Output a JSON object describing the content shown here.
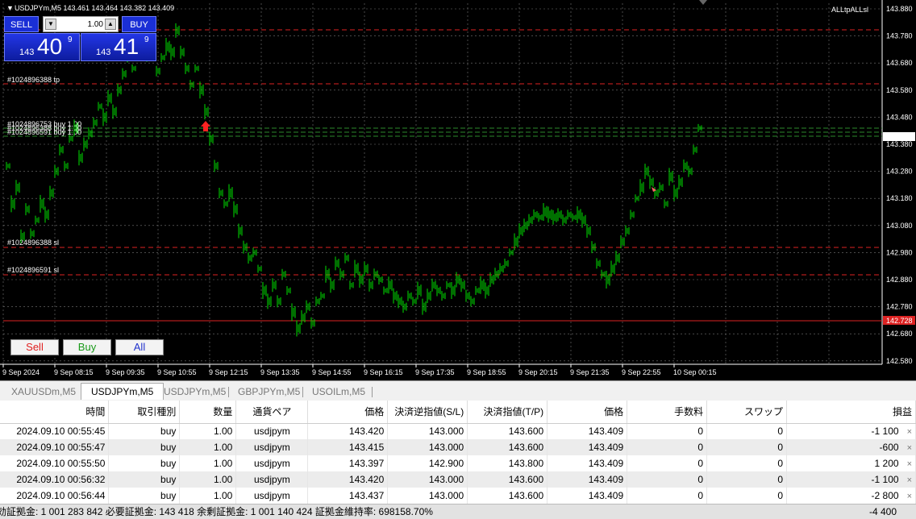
{
  "chart": {
    "symbol_header": "USDJPYm,M5  143.461 143.464 143.382 143.409",
    "ea_label": "ALLtpALLsl",
    "price_labels": [
      "143.880",
      "143.780",
      "143.680",
      "143.580",
      "143.480",
      "143.380",
      "143.280",
      "143.180",
      "143.080",
      "142.980",
      "142.880",
      "142.780",
      "142.680",
      "142.580"
    ],
    "current_price": "143.409",
    "red_price": "142.728",
    "time_labels": [
      "9 Sep 2024",
      "9 Sep 08:15",
      "9 Sep 09:35",
      "9 Sep 10:55",
      "9 Sep 12:15",
      "9 Sep 13:35",
      "9 Sep 14:55",
      "9 Sep 16:15",
      "9 Sep 17:35",
      "9 Sep 18:55",
      "9 Sep 20:15",
      "9 Sep 21:35",
      "9 Sep 22:55",
      "10 Sep 00:15"
    ],
    "order_labels": {
      "tp": "#1024896388 tp",
      "buys": [
        "#1024896753 buy 1.00",
        "#1024896388 buy 1.00",
        "#1024896591 buy 1.00"
      ],
      "sl1": "#1024896388 sl",
      "sl2": "#1024896591 sl"
    }
  },
  "trade_panel": {
    "sell_label": "SELL",
    "buy_label": "BUY",
    "lot": "1.00",
    "sell_small": "143",
    "sell_big": "40",
    "sell_sup": "9",
    "buy_small": "143",
    "buy_big": "41",
    "buy_sup": "9",
    "colors": {
      "panel": "#1a2fd6"
    }
  },
  "chart_buttons": {
    "sell": "Sell",
    "buy": "Buy",
    "all": "All"
  },
  "tabs": [
    "XAUUSDm,M5",
    "USDJPYm,M5",
    "USDJPYm,M5",
    "GBPJPYm,M5",
    "USOILm,M5"
  ],
  "table": {
    "headers": [
      "時間",
      "取引種別",
      "数量",
      "通貨ペア",
      "価格",
      "決済逆指値(S/L)",
      "決済指値(T/P)",
      "価格",
      "手数料",
      "スワップ",
      "損益"
    ],
    "rows": [
      [
        "2024.09.10 00:55:45",
        "buy",
        "1.00",
        "usdjpym",
        "143.420",
        "143.000",
        "143.600",
        "143.409",
        "0",
        "0",
        "-1 100"
      ],
      [
        "2024.09.10 00:55:47",
        "buy",
        "1.00",
        "usdjpym",
        "143.415",
        "143.000",
        "143.600",
        "143.409",
        "0",
        "0",
        "-600"
      ],
      [
        "2024.09.10 00:55:50",
        "buy",
        "1.00",
        "usdjpym",
        "143.397",
        "142.900",
        "143.800",
        "143.409",
        "0",
        "0",
        "1 200"
      ],
      [
        "2024.09.10 00:56:32",
        "buy",
        "1.00",
        "usdjpym",
        "143.420",
        "143.000",
        "143.600",
        "143.409",
        "0",
        "0",
        "-1 100"
      ],
      [
        "2024.09.10 00:56:44",
        "buy",
        "1.00",
        "usdjpym",
        "143.437",
        "143.000",
        "143.600",
        "143.409",
        "0",
        "0",
        "-2 800"
      ]
    ],
    "close_icon": "×"
  },
  "status": {
    "summary": "効証拠金: 1 001 283 842  必要証拠金: 143 418  余剰証拠金: 1 001 140 424  証拠金維持率: 698158.70%",
    "total": "-4 400"
  }
}
